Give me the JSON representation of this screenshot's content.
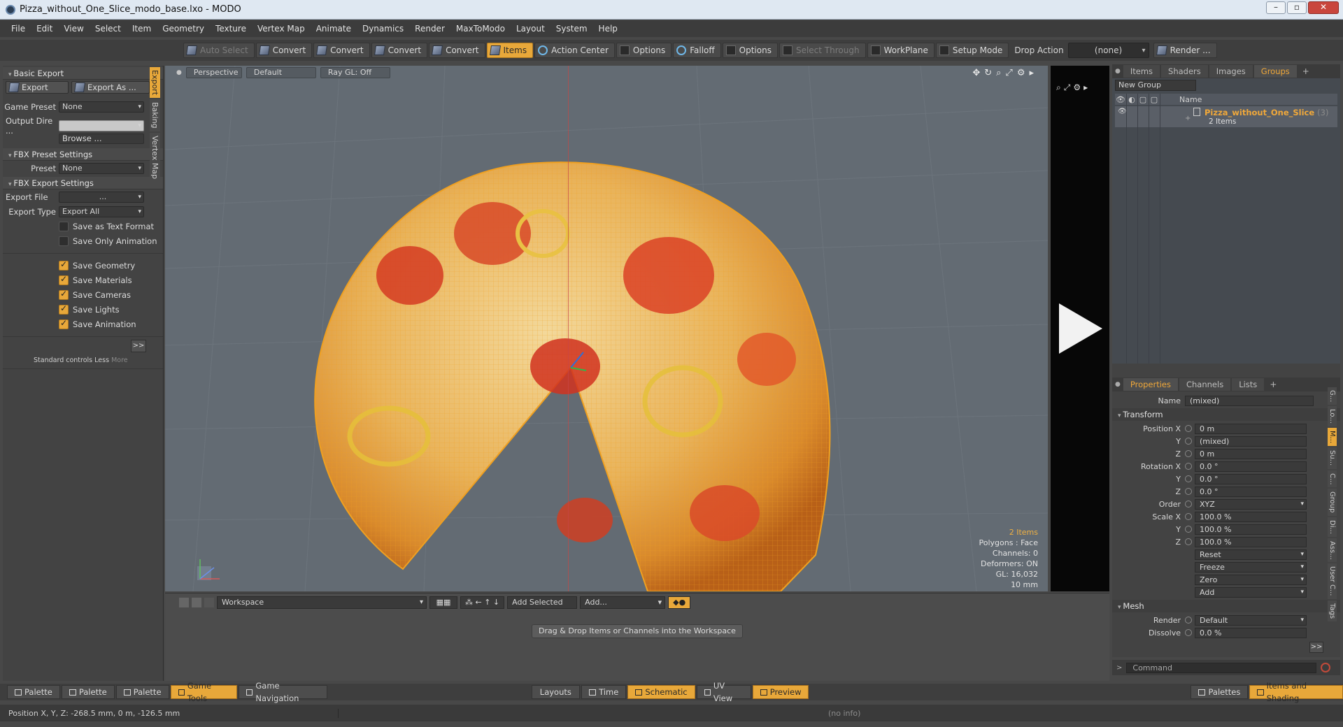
{
  "window": {
    "title": "Pizza_without_One_Slice_modo_base.lxo - MODO"
  },
  "menu": [
    "File",
    "Edit",
    "View",
    "Select",
    "Item",
    "Geometry",
    "Texture",
    "Vertex Map",
    "Animate",
    "Dynamics",
    "Render",
    "MaxToModo",
    "Layout",
    "System",
    "Help"
  ],
  "toolbar": {
    "auto_select": "Auto Select",
    "convert1": "Convert",
    "convert2": "Convert",
    "convert3": "Convert",
    "convert4": "Convert",
    "items": "Items",
    "action_center": "Action Center",
    "options1": "Options",
    "falloff": "Falloff",
    "options2": "Options",
    "select_through": "Select Through",
    "workplane": "WorkPlane",
    "setup_mode": "Setup Mode",
    "drop_action": "Drop Action",
    "drop_value": "(none)",
    "render": "Render ..."
  },
  "left": {
    "basic_export": "Basic Export",
    "export": "Export",
    "export_as": "Export As ...",
    "game_preset_label": "Game Preset",
    "game_preset_value": "None",
    "output_dir_label": "Output Dire ...",
    "browse": "Browse ...",
    "fbx_preset_settings": "FBX Preset Settings",
    "preset_label": "Preset",
    "preset_value": "None",
    "fbx_export_settings": "FBX Export Settings",
    "export_file_label": "Export File",
    "export_file_value": "...",
    "export_type_label": "Export Type",
    "export_type_value": "Export All",
    "options": [
      {
        "label": "Save as Text Format",
        "checked": false
      },
      {
        "label": "Save Only Animation",
        "checked": false
      },
      {
        "label": "Save Geometry",
        "checked": true
      },
      {
        "label": "Save Materials",
        "checked": true
      },
      {
        "label": "Save Cameras",
        "checked": true
      },
      {
        "label": "Save Lights",
        "checked": true
      },
      {
        "label": "Save Animation",
        "checked": true
      }
    ],
    "more_btn": ">>",
    "standard_controls": "Standard controls",
    "less": "Less",
    "more": "More",
    "vtabs": [
      "Export",
      "Baking",
      "Vertex Map"
    ]
  },
  "viewport": {
    "perspective": "Perspective",
    "default": "Default",
    "raygl": "Ray GL: Off",
    "info_items": "2 Items",
    "info_polygons": "Polygons : Face",
    "info_channels": "Channels: 0",
    "info_deformers": "Deformers: ON",
    "info_gl": "GL: 16,032",
    "info_scale": "10 mm"
  },
  "right_top": {
    "tabs": [
      "Items",
      "Shaders",
      "Images",
      "Groups"
    ],
    "active_tab": "Groups",
    "new_group": "New Group",
    "name_col": "Name",
    "group_name": "Pizza_without_One_Slice",
    "group_count": "(3)",
    "group_items": "2 Items"
  },
  "properties": {
    "tabs": [
      "Properties",
      "Channels",
      "Lists"
    ],
    "name_label": "Name",
    "name_value": "(mixed)",
    "transform": "Transform",
    "position_x_label": "Position X",
    "position_x": "0 m",
    "y_label": "Y",
    "position_y": "(mixed)",
    "z_label": "Z",
    "position_z": "0 m",
    "rotation_x_label": "Rotation X",
    "rotation_x": "0.0 °",
    "rotation_y": "0.0 °",
    "rotation_z": "0.0 °",
    "order_label": "Order",
    "order": "XYZ",
    "scale_x_label": "Scale X",
    "scale_x": "100.0 %",
    "scale_y": "100.0 %",
    "scale_z": "100.0 %",
    "reset": "Reset",
    "freeze": "Freeze",
    "zero": "Zero",
    "add": "Add",
    "mesh": "Mesh",
    "render_label": "Render",
    "render_value": "Default",
    "dissolve_label": "Dissolve",
    "dissolve_value": "0.0 %",
    "side_tabs": [
      "G...",
      "Lo...",
      "M...",
      "Su...",
      "C...",
      "Group",
      "Di...",
      "Ass...",
      "User C...",
      "Tags"
    ]
  },
  "command": {
    "placeholder": "Command"
  },
  "workspace": {
    "selector": "Workspace",
    "add_selected": "Add Selected",
    "add": "Add...",
    "hint": "Drag & Drop Items or Channels into the Workspace"
  },
  "bottom": {
    "palette1": "Palette",
    "palette2": "Palette",
    "palette3": "Palette",
    "game_tools": "Game Tools",
    "game_navigation": "Game Navigation",
    "layouts": "Layouts",
    "time": "Time",
    "schematic": "Schematic",
    "uv_view": "UV View",
    "preview": "Preview",
    "palettes": "Palettes",
    "items_shading": "Items and Shading"
  },
  "status": {
    "position": "Position X, Y, Z:  -268.5 mm, 0 m, -126.5 mm",
    "info": "(no info)"
  },
  "colors": {
    "accent": "#e8a83a",
    "viewport_bg": "#636b73"
  }
}
